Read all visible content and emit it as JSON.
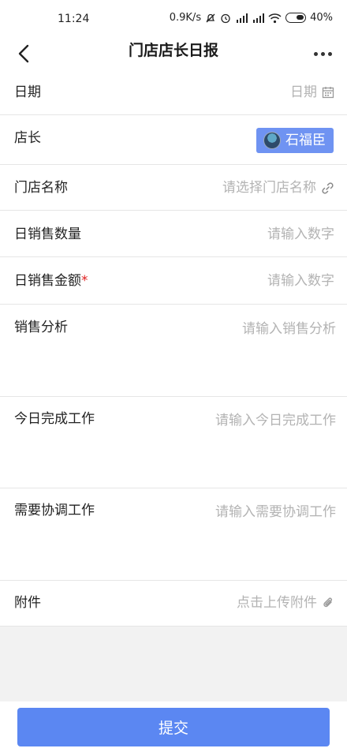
{
  "status_bar": {
    "time": "11:24",
    "net_speed": "0.9K/s",
    "battery": "40%"
  },
  "nav": {
    "title": "门店店长日报",
    "back_icon": "chevron-left-icon",
    "more_icon": "more-dots-icon"
  },
  "form": {
    "date": {
      "label": "日期",
      "placeholder": "日期",
      "icon": "calendar-icon"
    },
    "manager": {
      "label": "店长",
      "value": "石福臣"
    },
    "store": {
      "label": "门店名称",
      "placeholder": "请选择门店名称",
      "icon": "link-icon"
    },
    "sales_qty": {
      "label": "日销售数量",
      "placeholder": "请输入数字"
    },
    "sales_amount": {
      "label": "日销售金额",
      "required_mark": "*",
      "placeholder": "请输入数字"
    },
    "analysis": {
      "label": "销售分析",
      "placeholder": "请输入销售分析"
    },
    "completed": {
      "label": "今日完成工作",
      "placeholder": "请输入今日完成工作"
    },
    "coordination": {
      "label": "需要协调工作",
      "placeholder": "请输入需要协调工作"
    },
    "attachment": {
      "label": "附件",
      "placeholder": "点击上传附件",
      "icon": "paperclip-icon"
    }
  },
  "submit_label": "提交",
  "colors": {
    "primary": "#5b87f2",
    "chip": "#6f93f2",
    "placeholder": "#b3b3b3",
    "required": "#e02020"
  }
}
